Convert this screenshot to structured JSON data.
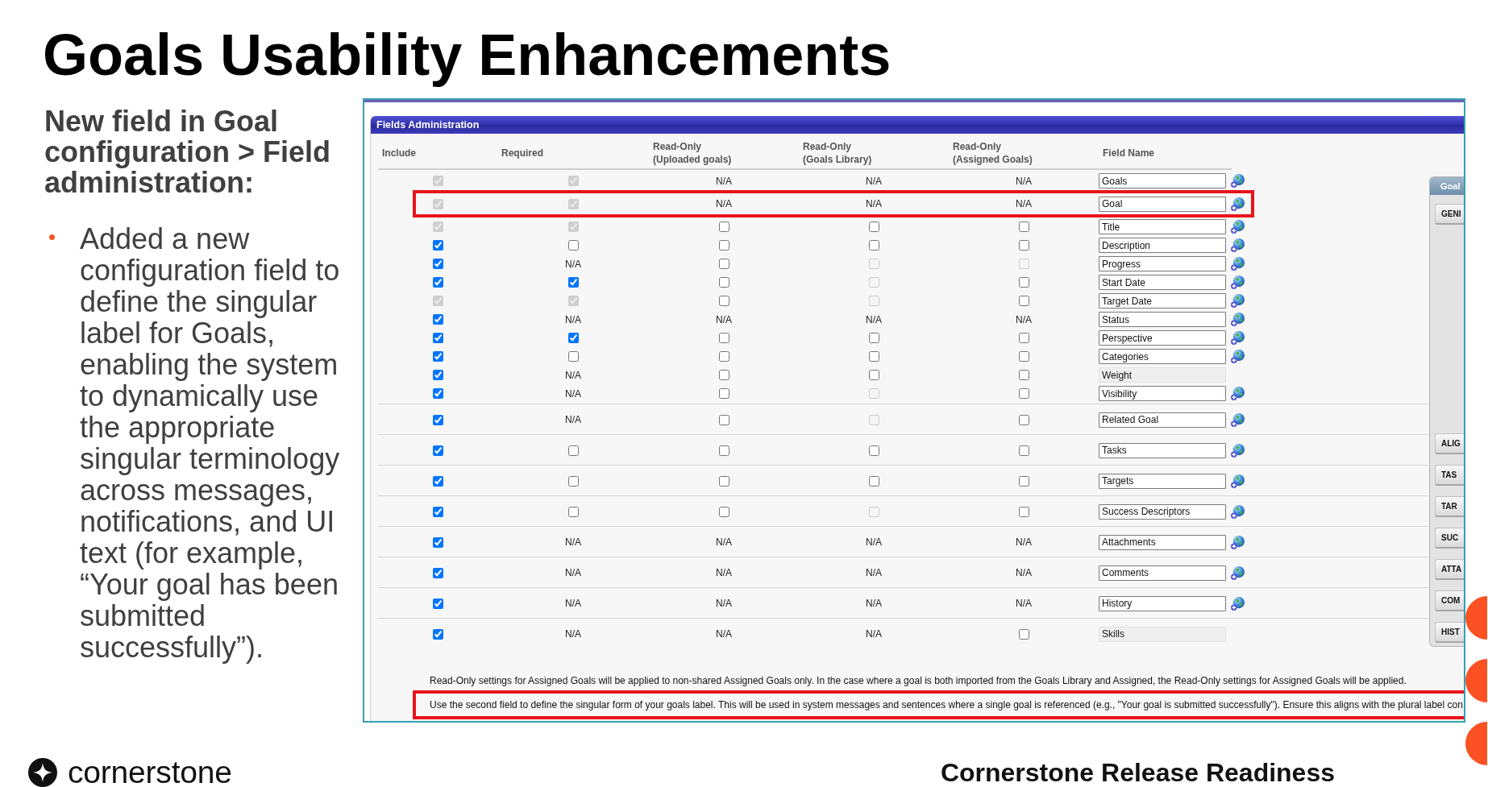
{
  "title": "Goals Usability Enhancements",
  "summary": {
    "heading": "New field in Goal configuration > Field administration:",
    "bullets": [
      "Added a new configuration field to define the singular label for Goals, enabling the system to dynamically use the appropriate singular terminology across messages, notifications, and UI text (for example, “Your goal has been submitted successfully”)."
    ]
  },
  "screenshot": {
    "panel_title": "Fields Administration",
    "columns": [
      [
        "Include"
      ],
      [
        "Required"
      ],
      [
        "Read-Only",
        "(Uploaded goals)"
      ],
      [
        "Read-Only",
        "(Goals Library)"
      ],
      [
        "Read-Only",
        "(Assigned Goals)"
      ],
      [
        "Field Name"
      ]
    ],
    "sections": [
      {
        "rows": [
          {
            "cells": [
              {
                "kind": "checkbox",
                "checked": true,
                "disabled": true
              },
              {
                "kind": "checkbox",
                "checked": true,
                "disabled": true
              },
              {
                "kind": "text",
                "text": "N/A"
              },
              {
                "kind": "text",
                "text": "N/A"
              },
              {
                "kind": "text",
                "text": "N/A"
              }
            ],
            "field_name": "Goals",
            "field_disabled": false,
            "highlighted": false
          },
          {
            "cells": [
              {
                "kind": "checkbox",
                "checked": true,
                "disabled": true
              },
              {
                "kind": "checkbox",
                "checked": true,
                "disabled": true
              },
              {
                "kind": "text",
                "text": "N/A"
              },
              {
                "kind": "text",
                "text": "N/A"
              },
              {
                "kind": "text",
                "text": "N/A"
              }
            ],
            "field_name": "Goal",
            "field_disabled": false,
            "highlighted": true
          },
          {
            "cells": [
              {
                "kind": "checkbox",
                "checked": true,
                "disabled": true
              },
              {
                "kind": "checkbox",
                "checked": true,
                "disabled": true
              },
              {
                "kind": "checkbox",
                "checked": false,
                "disabled": false
              },
              {
                "kind": "checkbox",
                "checked": false,
                "disabled": false
              },
              {
                "kind": "checkbox",
                "checked": false,
                "disabled": false
              }
            ],
            "field_name": "Title",
            "field_disabled": false,
            "highlighted": false
          },
          {
            "cells": [
              {
                "kind": "checkbox",
                "checked": true,
                "disabled": false
              },
              {
                "kind": "checkbox",
                "checked": false,
                "disabled": false
              },
              {
                "kind": "checkbox",
                "checked": false,
                "disabled": false
              },
              {
                "kind": "checkbox",
                "checked": false,
                "disabled": false
              },
              {
                "kind": "checkbox",
                "checked": false,
                "disabled": false
              }
            ],
            "field_name": "Description",
            "field_disabled": false,
            "highlighted": false
          },
          {
            "cells": [
              {
                "kind": "checkbox",
                "checked": true,
                "disabled": false
              },
              {
                "kind": "text",
                "text": "N/A"
              },
              {
                "kind": "checkbox",
                "checked": false,
                "disabled": false
              },
              {
                "kind": "checkbox",
                "checked": false,
                "disabled": true
              },
              {
                "kind": "checkbox",
                "checked": false,
                "disabled": true
              }
            ],
            "field_name": "Progress",
            "field_disabled": false,
            "highlighted": false
          },
          {
            "cells": [
              {
                "kind": "checkbox",
                "checked": true,
                "disabled": false
              },
              {
                "kind": "checkbox",
                "checked": true,
                "disabled": false
              },
              {
                "kind": "checkbox",
                "checked": false,
                "disabled": false
              },
              {
                "kind": "checkbox",
                "checked": false,
                "disabled": true
              },
              {
                "kind": "checkbox",
                "checked": false,
                "disabled": false
              }
            ],
            "field_name": "Start Date",
            "field_disabled": false,
            "highlighted": false
          },
          {
            "cells": [
              {
                "kind": "checkbox",
                "checked": true,
                "disabled": true
              },
              {
                "kind": "checkbox",
                "checked": true,
                "disabled": true
              },
              {
                "kind": "checkbox",
                "checked": false,
                "disabled": false
              },
              {
                "kind": "checkbox",
                "checked": false,
                "disabled": true
              },
              {
                "kind": "checkbox",
                "checked": false,
                "disabled": false
              }
            ],
            "field_name": "Target Date",
            "field_disabled": false,
            "highlighted": false
          },
          {
            "cells": [
              {
                "kind": "checkbox",
                "checked": true,
                "disabled": false
              },
              {
                "kind": "text",
                "text": "N/A"
              },
              {
                "kind": "text",
                "text": "N/A"
              },
              {
                "kind": "text",
                "text": "N/A"
              },
              {
                "kind": "text",
                "text": "N/A"
              }
            ],
            "field_name": "Status",
            "field_disabled": false,
            "highlighted": false
          },
          {
            "cells": [
              {
                "kind": "checkbox",
                "checked": true,
                "disabled": false
              },
              {
                "kind": "checkbox",
                "checked": true,
                "disabled": false
              },
              {
                "kind": "checkbox",
                "checked": false,
                "disabled": false
              },
              {
                "kind": "checkbox",
                "checked": false,
                "disabled": false
              },
              {
                "kind": "checkbox",
                "checked": false,
                "disabled": false
              }
            ],
            "field_name": "Perspective",
            "field_disabled": false,
            "highlighted": false
          },
          {
            "cells": [
              {
                "kind": "checkbox",
                "checked": true,
                "disabled": false
              },
              {
                "kind": "checkbox",
                "checked": false,
                "disabled": false
              },
              {
                "kind": "checkbox",
                "checked": false,
                "disabled": false
              },
              {
                "kind": "checkbox",
                "checked": false,
                "disabled": false
              },
              {
                "kind": "checkbox",
                "checked": false,
                "disabled": false
              }
            ],
            "field_name": "Categories",
            "field_disabled": false,
            "highlighted": false
          },
          {
            "cells": [
              {
                "kind": "checkbox",
                "checked": true,
                "disabled": false
              },
              {
                "kind": "text",
                "text": "N/A"
              },
              {
                "kind": "checkbox",
                "checked": false,
                "disabled": false
              },
              {
                "kind": "checkbox",
                "checked": false,
                "disabled": false
              },
              {
                "kind": "checkbox",
                "checked": false,
                "disabled": false
              }
            ],
            "field_name": "Weight",
            "field_disabled": true,
            "highlighted": false
          },
          {
            "cells": [
              {
                "kind": "checkbox",
                "checked": true,
                "disabled": false
              },
              {
                "kind": "text",
                "text": "N/A"
              },
              {
                "kind": "checkbox",
                "checked": false,
                "disabled": false
              },
              {
                "kind": "checkbox",
                "checked": false,
                "disabled": true
              },
              {
                "kind": "checkbox",
                "checked": false,
                "disabled": false
              }
            ],
            "field_name": "Visibility",
            "field_disabled": false,
            "highlighted": false
          }
        ]
      },
      {
        "rows": [
          {
            "cells": [
              {
                "kind": "checkbox",
                "checked": true,
                "disabled": false
              },
              {
                "kind": "text",
                "text": "N/A"
              },
              {
                "kind": "checkbox",
                "checked": false,
                "disabled": false
              },
              {
                "kind": "checkbox",
                "checked": false,
                "disabled": true
              },
              {
                "kind": "checkbox",
                "checked": false,
                "disabled": false
              }
            ],
            "field_name": "Related Goal",
            "field_disabled": false,
            "highlighted": false
          }
        ]
      },
      {
        "rows": [
          {
            "cells": [
              {
                "kind": "checkbox",
                "checked": true,
                "disabled": false
              },
              {
                "kind": "checkbox",
                "checked": false,
                "disabled": false
              },
              {
                "kind": "checkbox",
                "checked": false,
                "disabled": false
              },
              {
                "kind": "checkbox",
                "checked": false,
                "disabled": false
              },
              {
                "kind": "checkbox",
                "checked": false,
                "disabled": false
              }
            ],
            "field_name": "Tasks",
            "field_disabled": false,
            "highlighted": false
          }
        ]
      },
      {
        "rows": [
          {
            "cells": [
              {
                "kind": "checkbox",
                "checked": true,
                "disabled": false
              },
              {
                "kind": "checkbox",
                "checked": false,
                "disabled": false
              },
              {
                "kind": "checkbox",
                "checked": false,
                "disabled": false
              },
              {
                "kind": "checkbox",
                "checked": false,
                "disabled": false
              },
              {
                "kind": "checkbox",
                "checked": false,
                "disabled": false
              }
            ],
            "field_name": "Targets",
            "field_disabled": false,
            "highlighted": false
          }
        ]
      },
      {
        "rows": [
          {
            "cells": [
              {
                "kind": "checkbox",
                "checked": true,
                "disabled": false
              },
              {
                "kind": "checkbox",
                "checked": false,
                "disabled": false
              },
              {
                "kind": "checkbox",
                "checked": false,
                "disabled": false
              },
              {
                "kind": "checkbox",
                "checked": false,
                "disabled": true
              },
              {
                "kind": "checkbox",
                "checked": false,
                "disabled": false
              }
            ],
            "field_name": "Success Descriptors",
            "field_disabled": false,
            "highlighted": false
          }
        ]
      },
      {
        "rows": [
          {
            "cells": [
              {
                "kind": "checkbox",
                "checked": true,
                "disabled": false
              },
              {
                "kind": "text",
                "text": "N/A"
              },
              {
                "kind": "text",
                "text": "N/A"
              },
              {
                "kind": "text",
                "text": "N/A"
              },
              {
                "kind": "text",
                "text": "N/A"
              }
            ],
            "field_name": "Attachments",
            "field_disabled": false,
            "highlighted": false
          }
        ]
      },
      {
        "rows": [
          {
            "cells": [
              {
                "kind": "checkbox",
                "checked": true,
                "disabled": false
              },
              {
                "kind": "text",
                "text": "N/A"
              },
              {
                "kind": "text",
                "text": "N/A"
              },
              {
                "kind": "text",
                "text": "N/A"
              },
              {
                "kind": "text",
                "text": "N/A"
              }
            ],
            "field_name": "Comments",
            "field_disabled": false,
            "highlighted": false
          }
        ]
      },
      {
        "rows": [
          {
            "cells": [
              {
                "kind": "checkbox",
                "checked": true,
                "disabled": false
              },
              {
                "kind": "text",
                "text": "N/A"
              },
              {
                "kind": "text",
                "text": "N/A"
              },
              {
                "kind": "text",
                "text": "N/A"
              },
              {
                "kind": "text",
                "text": "N/A"
              }
            ],
            "field_name": "History",
            "field_disabled": false,
            "highlighted": false
          }
        ]
      },
      {
        "rows": [
          {
            "cells": [
              {
                "kind": "checkbox",
                "checked": true,
                "disabled": false
              },
              {
                "kind": "text",
                "text": "N/A"
              },
              {
                "kind": "text",
                "text": "N/A"
              },
              {
                "kind": "text",
                "text": "N/A"
              },
              {
                "kind": "checkbox",
                "checked": false,
                "disabled": false
              }
            ],
            "field_name": "Skills",
            "field_disabled": true,
            "highlighted": false
          }
        ]
      }
    ],
    "notes": [
      {
        "text": "Read-Only settings for Assigned Goals will be applied to non-shared Assigned Goals only. In the case where a goal is both imported from the Goals Library and Assigned, the Read-Only settings for Assigned Goals will be applied.",
        "highlighted": false
      },
      {
        "text": "Use the second field to define the singular form of your goals label. This will be used in system messages and sentences where a single goal is referenced (e.g., \"Your goal is submitted successfully\"). Ensure this aligns with the plural label con",
        "highlighted": true
      }
    ],
    "side_panel": {
      "title": "Goal",
      "tabs_top": [
        "GENI"
      ],
      "tabs_bottom": [
        "ALIG",
        "TAS",
        "TAR",
        "SUC",
        "ATTA",
        "COM",
        "HIST"
      ]
    }
  },
  "footer": {
    "brand": "cornerstone",
    "caption": "Cornerstone Release Readiness"
  }
}
